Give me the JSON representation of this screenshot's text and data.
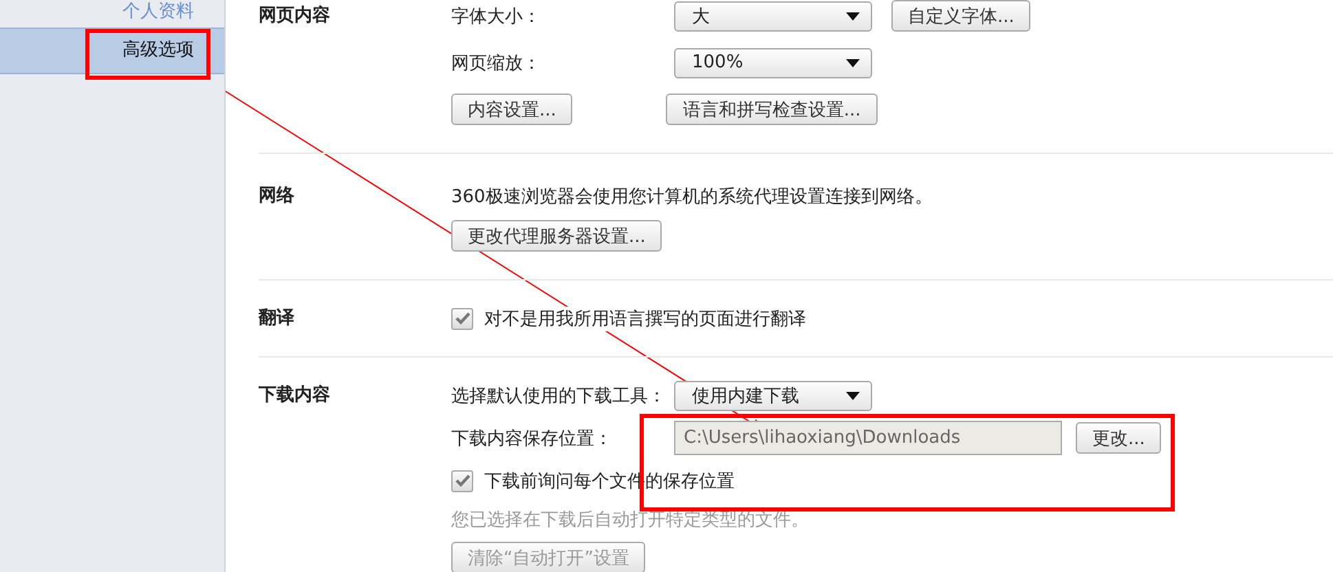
{
  "sidebar": {
    "items": [
      {
        "label": "个人资料",
        "selected": false
      },
      {
        "label": "高级选项",
        "selected": true
      }
    ]
  },
  "sections": [
    {
      "title": "网页内容",
      "rows": [
        {
          "kind": "select",
          "label": "字体大小：",
          "value": "大",
          "buttons": [
            {
              "label": "自定义字体...",
              "disabled": false
            }
          ]
        },
        {
          "kind": "select",
          "label": "网页缩放：",
          "value": "100%"
        },
        {
          "kind": "buttons",
          "buttons": [
            {
              "label": "内容设置...",
              "disabled": false
            },
            {
              "label": "语言和拼写检查设置...",
              "disabled": false
            }
          ]
        }
      ]
    },
    {
      "title": "网络",
      "rows": [
        {
          "kind": "text",
          "text": "360极速浏览器会使用您计算机的系统代理设置连接到网络。"
        },
        {
          "kind": "buttons",
          "buttons": [
            {
              "label": "更改代理服务器设置...",
              "disabled": false
            }
          ]
        }
      ]
    },
    {
      "title": "翻译",
      "rows": [
        {
          "kind": "checkbox",
          "label": "对不是用我所用语言撰写的页面进行翻译",
          "checked": true
        }
      ]
    },
    {
      "title": "下载内容",
      "rows": [
        {
          "kind": "select",
          "label": "选择默认使用的下载工具：",
          "value": "使用内建下载"
        },
        {
          "kind": "path",
          "label": "下载内容保存位置：",
          "value": "C:\\Users\\lihaoxiang\\Downloads",
          "button": {
            "label": "更改...",
            "disabled": false
          }
        },
        {
          "kind": "checkbox",
          "label": "下载前询问每个文件的保存位置",
          "checked": true
        },
        {
          "kind": "note",
          "text": "您已选择在下载后自动打开特定类型的文件。"
        },
        {
          "kind": "buttons",
          "buttons": [
            {
              "label": "清除“自动打开”设置",
              "disabled": true
            }
          ]
        }
      ]
    }
  ]
}
